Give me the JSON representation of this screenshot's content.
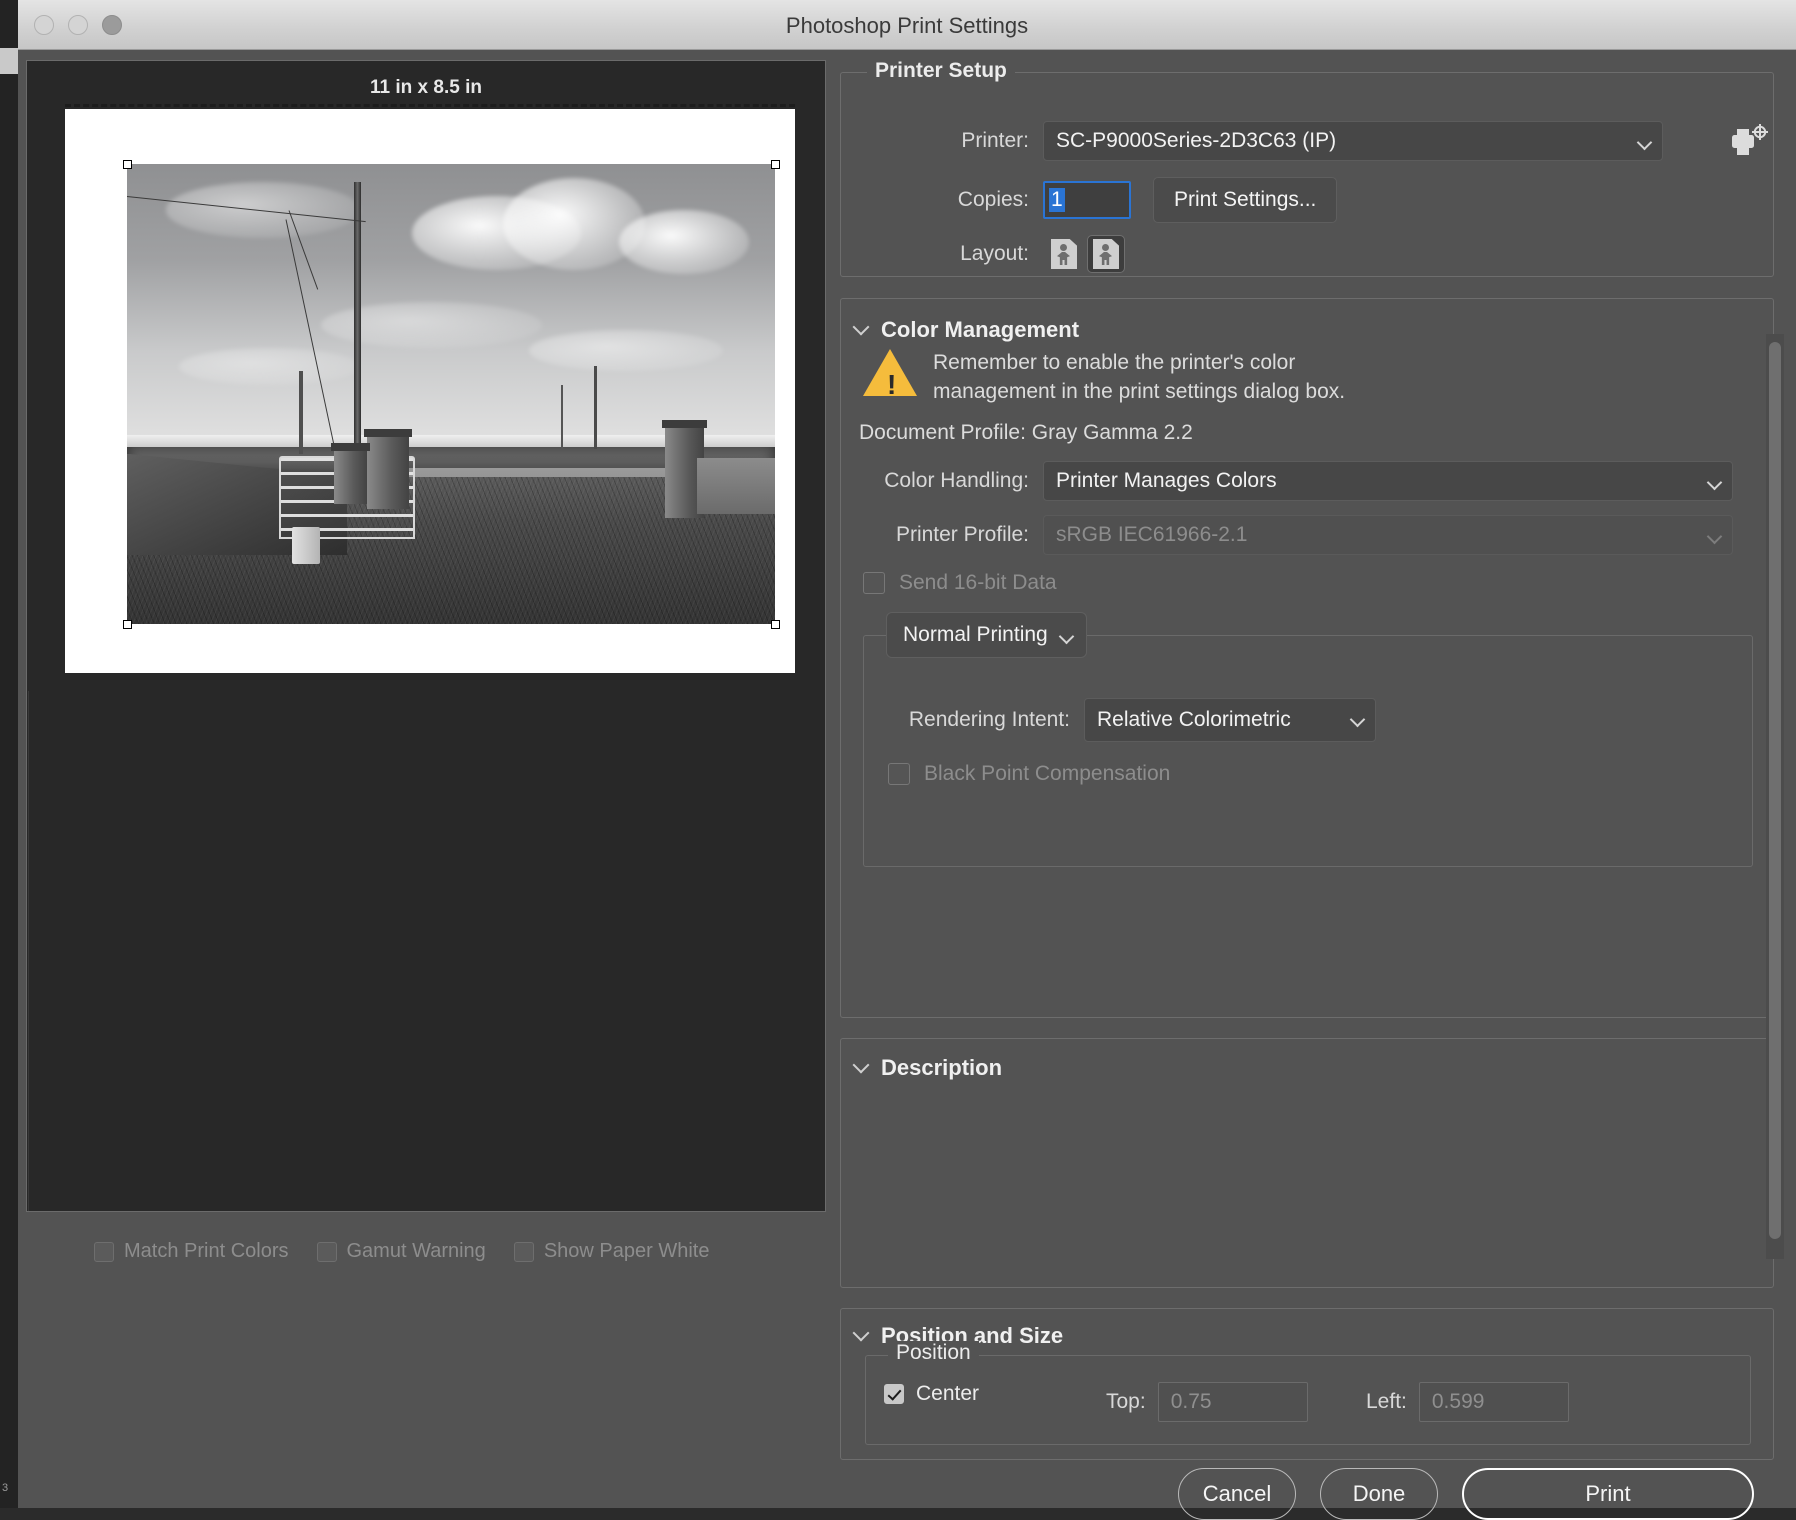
{
  "window": {
    "title": "Photoshop Print Settings",
    "traffic_lights": [
      "close",
      "minimize",
      "zoom"
    ]
  },
  "preview": {
    "size_label": "11 in x 8.5 in",
    "image_description": "black and white photograph of a rural farm gateway with stone wall, telephone pole, metal gate and gravel yard"
  },
  "bottom_checks": [
    {
      "label": "Match Print Colors",
      "checked": false
    },
    {
      "label": "Gamut Warning",
      "checked": false
    },
    {
      "label": "Show Paper White",
      "checked": false
    }
  ],
  "printer_setup": {
    "legend": "Printer Setup",
    "printer_label": "Printer:",
    "printer_value": "SC-P9000Series-2D3C63 (IP)",
    "printer_icon": "printer-registration-icon",
    "copies_label": "Copies:",
    "copies_value": "1",
    "print_settings_label": "Print Settings...",
    "layout_label": "Layout:",
    "layout_options": [
      {
        "name": "portrait",
        "selected": false
      },
      {
        "name": "landscape",
        "selected": true
      }
    ]
  },
  "color_management": {
    "title": "Color Management",
    "warning_icon": "warning-triangle-icon",
    "warning_line1": "Remember to enable the printer's color",
    "warning_line2": "management in the print settings dialog box.",
    "document_profile": "Document Profile: Gray Gamma 2.2",
    "color_handling_label": "Color Handling:",
    "color_handling_value": "Printer Manages Colors",
    "printer_profile_label": "Printer Profile:",
    "printer_profile_value": "sRGB IEC61966-2.1",
    "printer_profile_disabled": true,
    "send_16bit_label": "Send 16-bit Data",
    "send_16bit_checked": false,
    "send_16bit_disabled": true,
    "print_mode_value": "Normal Printing",
    "rendering_intent_label": "Rendering Intent:",
    "rendering_intent_value": "Relative Colorimetric",
    "black_point_label": "Black Point Compensation",
    "black_point_checked": false,
    "black_point_disabled": true
  },
  "description": {
    "title": "Description",
    "body": ""
  },
  "position_and_size": {
    "title": "Position and Size",
    "position_legend": "Position",
    "center_label": "Center",
    "center_checked": true,
    "top_label": "Top:",
    "top_value": "0.75",
    "left_label": "Left:",
    "left_value": "0.599"
  },
  "footer": {
    "cancel_label": "Cancel",
    "done_label": "Done",
    "print_label": "Print"
  },
  "colors": {
    "dialog_bg": "#535353",
    "preview_bg": "#282828",
    "titlebar": "#d2d2d2",
    "accent_selection": "#2a74d4",
    "warning_yellow": "#f5bc3c",
    "text_primary": "#f0f0f0",
    "text_disabled": "#8d8d8d"
  }
}
